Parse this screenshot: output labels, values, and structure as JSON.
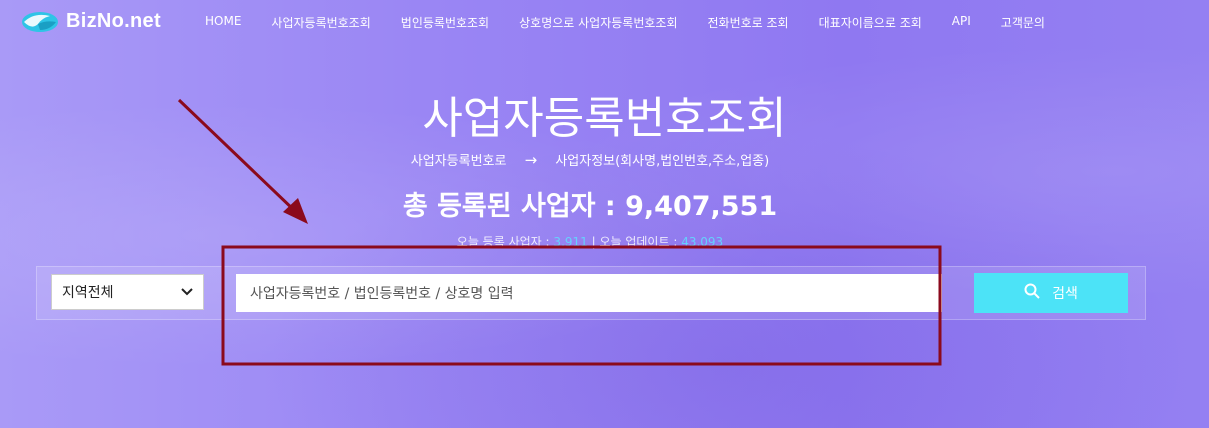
{
  "brand": {
    "name": "BizNo.net"
  },
  "nav": {
    "items": [
      "HOME",
      "사업자등록번호조회",
      "법인등록번호조회",
      "상호명으로 사업자등록번호조회",
      "전화번호로 조회",
      "대표자이름으로 조회",
      "API",
      "고객문의"
    ]
  },
  "hero": {
    "title": "사업자등록번호조회",
    "flow_from": "사업자등록번호로",
    "flow_arrow": "→",
    "flow_to": "사업자정보(회사명,법인번호,주소,업종)",
    "total_label": "총 등록된 사업자 : 9,407,551",
    "today_reg_label": "오늘 등록 사업자 :",
    "today_reg_value": "3,911",
    "today_sep": "|",
    "today_upd_label": "오늘 업데이트 :",
    "today_upd_value": "43,093"
  },
  "search": {
    "region_selected": "지역전체",
    "placeholder": "사업자등록번호 / 법인등록번호 / 상호명 입력",
    "button_label": "검색"
  },
  "colors": {
    "accent": "#4ce3f7",
    "annotation": "#8b0a1c",
    "count_highlight": "#5ee0ff"
  },
  "icons": {
    "logo": "biznodrop-logo-icon",
    "search": "search-icon",
    "select": "chevron-down-icon"
  }
}
